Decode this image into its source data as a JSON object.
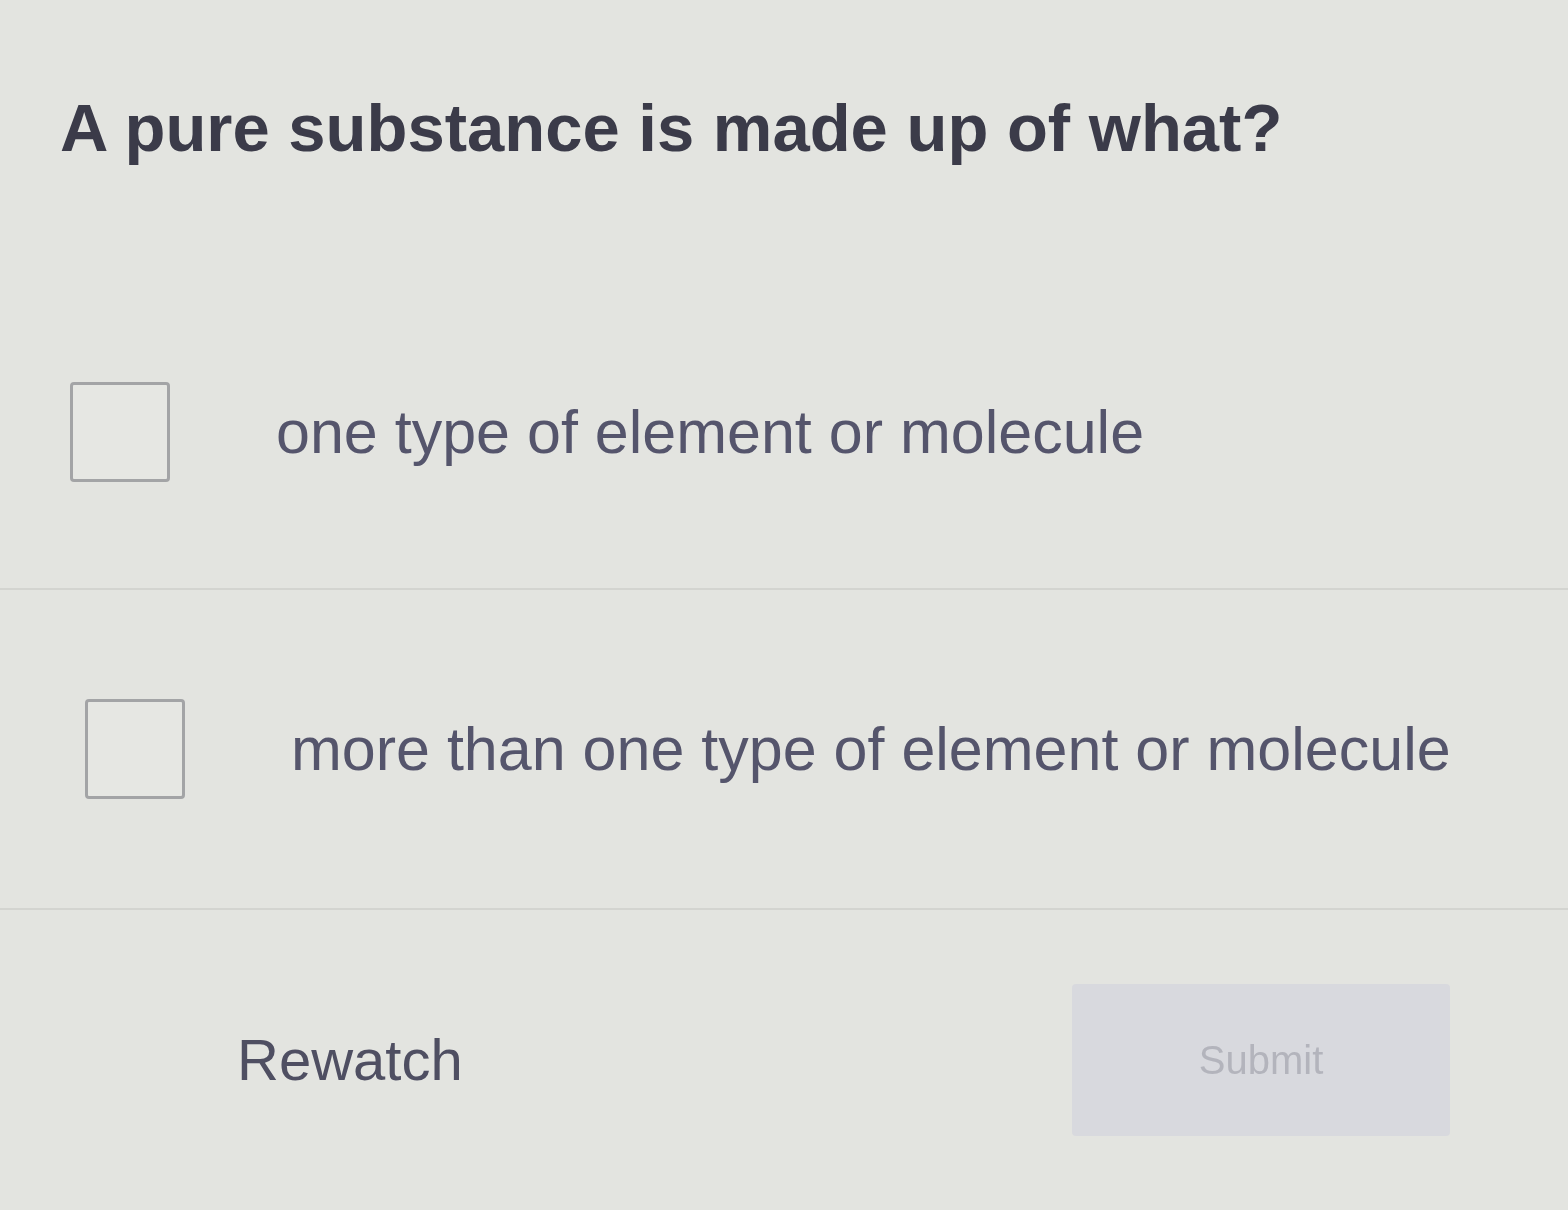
{
  "question": "A pure substance is made up of what?",
  "options": [
    {
      "label": "one type of element or molecule",
      "checked": false
    },
    {
      "label": "more than one type of element or molecule",
      "checked": false
    }
  ],
  "actions": {
    "rewatch": {
      "label": "Rewatch"
    },
    "submit": {
      "label": "Submit",
      "disabled": true
    }
  }
}
